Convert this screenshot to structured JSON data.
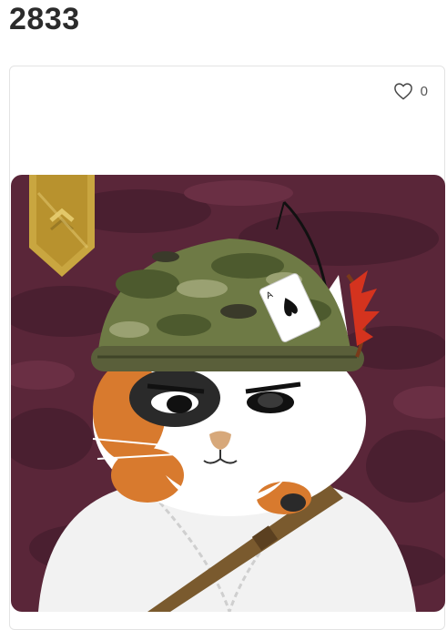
{
  "page": {
    "title": "2833"
  },
  "card": {
    "like": {
      "icon": "heart-icon",
      "count": "0"
    },
    "artwork": {
      "icon": "cat-soldier-nft-image"
    }
  },
  "colors": {
    "background": "#5a2639",
    "camo_dark": "#4a1f30",
    "helmet_green": "#6e7a45",
    "rank_badge": "#c9a640"
  }
}
